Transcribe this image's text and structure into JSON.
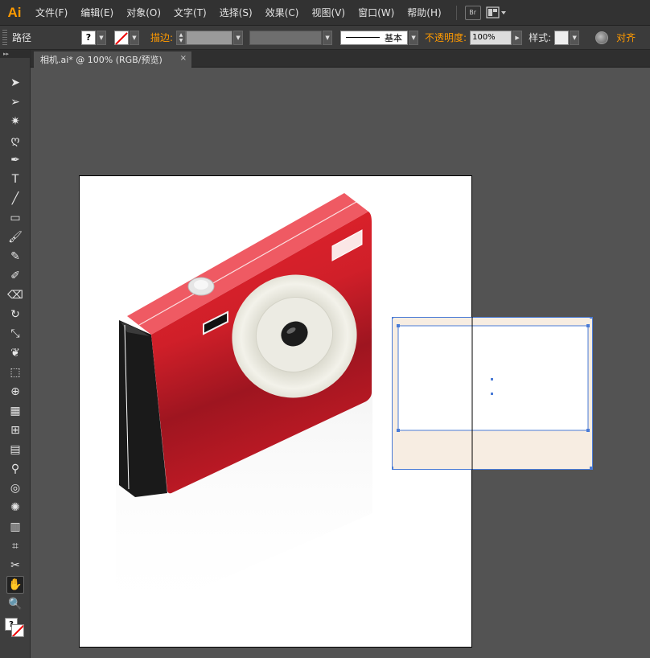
{
  "app": {
    "logo": "Ai"
  },
  "menu": {
    "items": [
      "文件(F)",
      "编辑(E)",
      "对象(O)",
      "文字(T)",
      "选择(S)",
      "效果(C)",
      "视图(V)",
      "窗口(W)",
      "帮助(H)"
    ],
    "bridge_label": "Br"
  },
  "control_bar": {
    "object_type": "路径",
    "fill_swatch_symbol": "?",
    "stroke_label": "描边:",
    "stroke_profile": "基本",
    "opacity_label": "不透明度:",
    "opacity_value": "100%",
    "style_label": "样式:",
    "align_label": "对齐"
  },
  "document_tab": {
    "title": "相机.ai* @ 100% (RGB/预览)",
    "close": "×"
  },
  "toolbox": {
    "tools": [
      "selection-tool",
      "direct-selection-tool",
      "magic-wand-tool",
      "lasso-tool",
      "pen-tool",
      "type-tool",
      "line-segment-tool",
      "rectangle-tool",
      "paintbrush-tool",
      "pencil-tool",
      "blob-brush-tool",
      "eraser-tool",
      "rotate-tool",
      "scale-tool",
      "warp-tool",
      "free-transform-tool",
      "shape-builder-tool",
      "perspective-grid-tool",
      "mesh-tool",
      "gradient-tool",
      "eyedropper-tool",
      "blend-tool",
      "symbol-sprayer-tool",
      "column-graph-tool",
      "artboard-tool",
      "slice-tool",
      "hand-tool",
      "zoom-tool"
    ],
    "active_tool": "hand-tool",
    "fill_symbol": "?"
  },
  "colors": {
    "camera_red": "#d8202a",
    "camera_top": "#ef5a63",
    "camera_side": "#1a1a1a",
    "lens_ring": "#efeee6",
    "selection_blue": "#4a7bd6",
    "polaroid_fill": "#f7ede2",
    "accent_orange": "#ff9a00"
  }
}
